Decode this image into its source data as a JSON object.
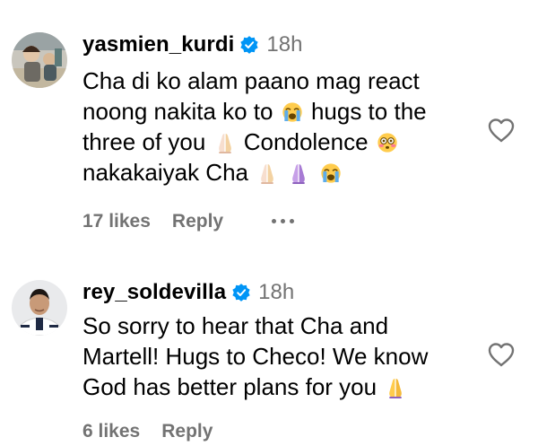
{
  "comments": [
    {
      "username": "yasmien_kurdi",
      "time": "18h",
      "lines": [
        [
          {
            "t": "text",
            "v": "Cha di ko alam paano mag react"
          }
        ],
        [
          {
            "t": "text",
            "v": "noong nakita ko to "
          },
          {
            "t": "emoji",
            "v": "loudly-crying-face"
          },
          {
            "t": "text",
            "v": " hugs to the"
          }
        ],
        [
          {
            "t": "text",
            "v": "three of you "
          },
          {
            "t": "emoji",
            "v": "folded-hands-light"
          },
          {
            "t": "text",
            "v": " Condolence "
          },
          {
            "t": "emoji",
            "v": "flushed-face"
          }
        ],
        [
          {
            "t": "text",
            "v": "nakakaiyak Cha "
          },
          {
            "t": "emoji",
            "v": "folded-hands-light"
          },
          {
            "t": "emoji",
            "v": "folded-hands-light"
          },
          {
            "t": "emoji",
            "v": "loudly-crying-face"
          }
        ]
      ],
      "likes": "17 likes",
      "reply": "Reply",
      "has_more_menu": true
    },
    {
      "username": "rey_soldevilla",
      "time": "18h",
      "lines": [
        [
          {
            "t": "text",
            "v": "So sorry to hear that Cha and"
          }
        ],
        [
          {
            "t": "text",
            "v": "Martell! Hugs to Checo! We know"
          }
        ],
        [
          {
            "t": "text",
            "v": "God has better plans for you "
          },
          {
            "t": "emoji",
            "v": "folded-hands-yellow"
          }
        ]
      ],
      "likes": "6 likes",
      "reply": "Reply",
      "has_more_menu": false
    }
  ],
  "icons": {
    "verified": "verified-badge-icon",
    "like": "heart-outline-icon",
    "more": "more-options-icon"
  },
  "colors": {
    "verified_blue": "#0095f6",
    "secondary_text": "#737373",
    "primary_text": "#000000"
  }
}
